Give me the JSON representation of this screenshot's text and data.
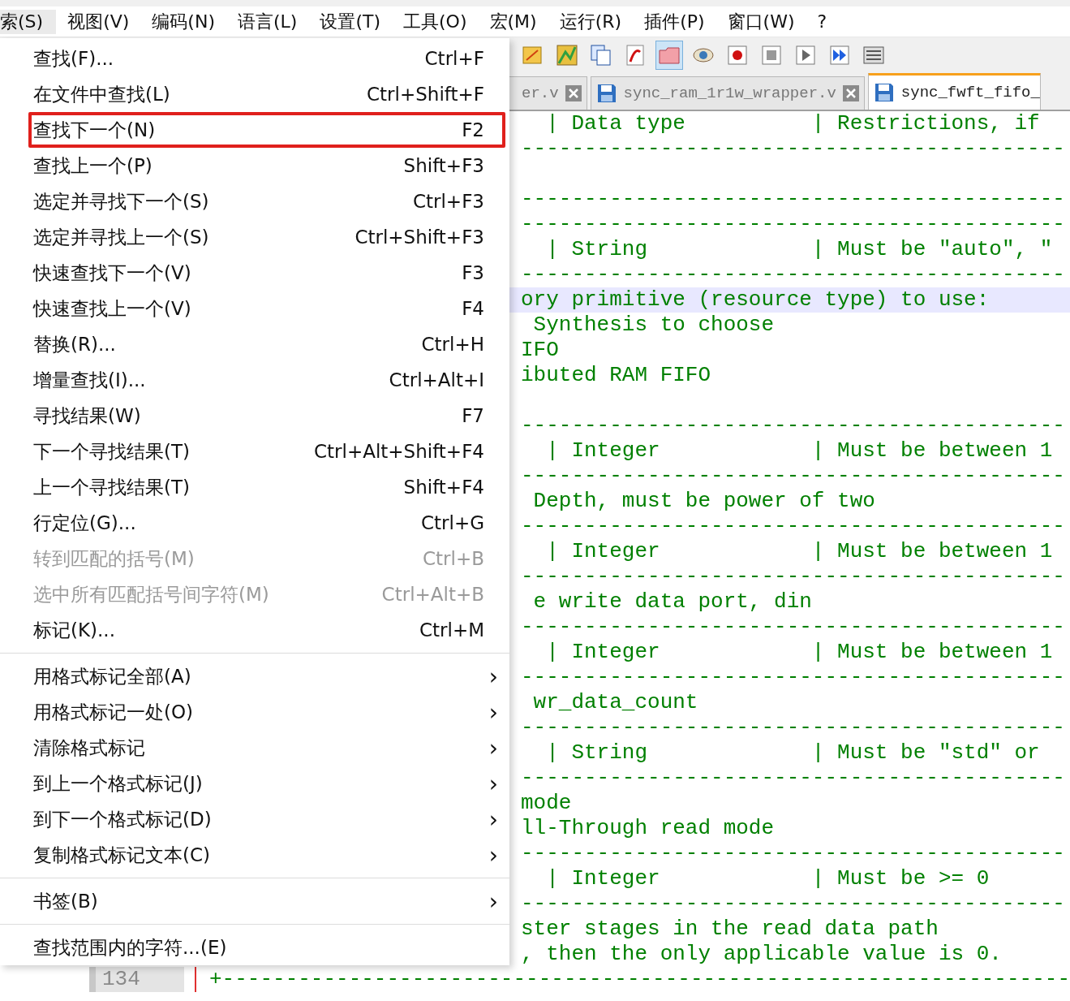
{
  "menubar": {
    "items": [
      {
        "label": "索(S)",
        "selected": true
      },
      {
        "label": "视图(V)",
        "selected": false
      },
      {
        "label": "编码(N)",
        "selected": false
      },
      {
        "label": "语言(L)",
        "selected": false
      },
      {
        "label": "设置(T)",
        "selected": false
      },
      {
        "label": "工具(O)",
        "selected": false
      },
      {
        "label": "宏(M)",
        "selected": false
      },
      {
        "label": "运行(R)",
        "selected": false
      },
      {
        "label": "插件(P)",
        "selected": false
      },
      {
        "label": "窗口(W)",
        "selected": false
      },
      {
        "label": "?",
        "selected": false
      }
    ]
  },
  "toolbar": {
    "buttons": [
      {
        "pressed": false
      },
      {
        "pressed": false
      },
      {
        "pressed": false
      },
      {
        "pressed": false
      },
      {
        "pressed": true
      },
      {
        "pressed": false
      },
      {
        "pressed": false
      },
      {
        "pressed": false
      },
      {
        "pressed": false
      },
      {
        "pressed": false
      },
      {
        "pressed": false
      }
    ]
  },
  "tabs": [
    {
      "label": "er.v",
      "selected": false,
      "closable": true,
      "icon": false
    },
    {
      "label": "sync_ram_1r1w_wrapper.v",
      "selected": false,
      "closable": true,
      "icon": true
    },
    {
      "label": "sync_fwft_fifo_",
      "selected": true,
      "closable": false,
      "icon": true
    }
  ],
  "editor": {
    "lines": [
      {
        "text": "  | Data type          | Restrictions, if",
        "highlighted": false
      },
      {
        "text": "-------------------------------------------",
        "highlighted": false
      },
      {
        "highlighted": false
      },
      {
        "text": "-------------------------------------------",
        "highlighted": false
      },
      {
        "text": "-------------------------------------------",
        "highlighted": false
      },
      {
        "text": "  | String             | Must be \"auto\", \"",
        "highlighted": false
      },
      {
        "text": "-------------------------------------------",
        "highlighted": false
      },
      {
        "text": "ory primitive (resource type) to use:",
        "highlighted": true
      },
      {
        "text": " Synthesis to choose",
        "highlighted": false
      },
      {
        "text": "IFO",
        "highlighted": false
      },
      {
        "text": "ibuted RAM FIFO",
        "highlighted": false
      },
      {
        "highlighted": false
      },
      {
        "text": "-------------------------------------------",
        "highlighted": false
      },
      {
        "text": "  | Integer            | Must be between 1",
        "highlighted": false
      },
      {
        "text": "-------------------------------------------",
        "highlighted": false
      },
      {
        "text": " Depth, must be power of two",
        "highlighted": false
      },
      {
        "text": "-------------------------------------------",
        "highlighted": false
      },
      {
        "text": "  | Integer            | Must be between 1",
        "highlighted": false
      },
      {
        "text": "-------------------------------------------",
        "highlighted": false
      },
      {
        "text": " e write data port, din",
        "highlighted": false
      },
      {
        "text": "-------------------------------------------",
        "highlighted": false
      },
      {
        "text": "  | Integer            | Must be between 1",
        "highlighted": false
      },
      {
        "text": "-------------------------------------------",
        "highlighted": false
      },
      {
        "text": " wr_data_count",
        "highlighted": false
      },
      {
        "text": "-------------------------------------------",
        "highlighted": false
      },
      {
        "text": "  | String             | Must be \"std\" or",
        "highlighted": false
      },
      {
        "text": "-------------------------------------------",
        "highlighted": false
      },
      {
        "text": "mode",
        "highlighted": false
      },
      {
        "text": "ll-Through read mode",
        "highlighted": false
      },
      {
        "text": "-------------------------------------------",
        "highlighted": false
      },
      {
        "text": "  | Integer            | Must be >= 0",
        "highlighted": false
      },
      {
        "text": "-------------------------------------------",
        "highlighted": false
      },
      {
        "text": "ster stages in the read data path",
        "highlighted": false
      },
      {
        "text": ", then the only applicable value is 0.",
        "highlighted": false
      }
    ],
    "last_line": {
      "number": "134",
      "text": "+-------------------------------------------------------------------"
    }
  },
  "menu": {
    "items": [
      {
        "kind": "command",
        "label": "查找(F)...",
        "shortcut": "Ctrl+F",
        "disabled": false,
        "annotated": false
      },
      {
        "kind": "command",
        "label": "在文件中查找(L)",
        "shortcut": "Ctrl+Shift+F",
        "disabled": false,
        "annotated": false
      },
      {
        "kind": "command",
        "label": "查找下一个(N)",
        "shortcut": "F2",
        "disabled": false,
        "annotated": true
      },
      {
        "kind": "command",
        "label": "查找上一个(P)",
        "shortcut": "Shift+F3",
        "disabled": false,
        "annotated": false
      },
      {
        "kind": "command",
        "label": "选定并寻找下一个(S)",
        "shortcut": "Ctrl+F3",
        "disabled": false,
        "annotated": false
      },
      {
        "kind": "command",
        "label": "选定并寻找上一个(S)",
        "shortcut": "Ctrl+Shift+F3",
        "disabled": false,
        "annotated": false
      },
      {
        "kind": "command",
        "label": "快速查找下一个(V)",
        "shortcut": "F3",
        "disabled": false,
        "annotated": false
      },
      {
        "kind": "command",
        "label": "快速查找上一个(V)",
        "shortcut": "F4",
        "disabled": false,
        "annotated": false
      },
      {
        "kind": "command",
        "label": "替换(R)...",
        "shortcut": "Ctrl+H",
        "disabled": false,
        "annotated": false
      },
      {
        "kind": "command",
        "label": "增量查找(I)...",
        "shortcut": "Ctrl+Alt+I",
        "disabled": false,
        "annotated": false
      },
      {
        "kind": "command",
        "label": "寻找结果(W)",
        "shortcut": "F7",
        "disabled": false,
        "annotated": false
      },
      {
        "kind": "command",
        "label": "下一个寻找结果(T)",
        "shortcut": "Ctrl+Alt+Shift+F4",
        "disabled": false,
        "annotated": false
      },
      {
        "kind": "command",
        "label": "上一个寻找结果(T)",
        "shortcut": "Shift+F4",
        "disabled": false,
        "annotated": false
      },
      {
        "kind": "command",
        "label": "行定位(G)...",
        "shortcut": "Ctrl+G",
        "disabled": false,
        "annotated": false
      },
      {
        "kind": "command",
        "label": "转到匹配的括号(M)",
        "shortcut": "Ctrl+B",
        "disabled": true,
        "annotated": false
      },
      {
        "kind": "command",
        "label": "选中所有匹配括号间字符(M)",
        "shortcut": "Ctrl+Alt+B",
        "disabled": true,
        "annotated": false
      },
      {
        "kind": "command",
        "label": "标记(K)...",
        "shortcut": "Ctrl+M",
        "disabled": false,
        "annotated": false
      },
      {
        "kind": "separator"
      },
      {
        "kind": "submenu",
        "label": "用格式标记全部(A)",
        "arrow": "›",
        "disabled": false,
        "annotated": false
      },
      {
        "kind": "submenu",
        "label": "用格式标记一处(O)",
        "arrow": "›",
        "disabled": false,
        "annotated": false
      },
      {
        "kind": "submenu",
        "label": "清除格式标记",
        "arrow": "›",
        "disabled": false,
        "annotated": false
      },
      {
        "kind": "submenu",
        "label": "到上一个格式标记(J)",
        "arrow": "›",
        "disabled": false,
        "annotated": false
      },
      {
        "kind": "submenu",
        "label": "到下一个格式标记(D)",
        "arrow": "›",
        "disabled": false,
        "annotated": false
      },
      {
        "kind": "submenu",
        "label": "复制格式标记文本(C)",
        "arrow": "›",
        "disabled": false,
        "annotated": false
      },
      {
        "kind": "separator"
      },
      {
        "kind": "submenu",
        "label": "书签(B)",
        "arrow": "›",
        "disabled": false,
        "annotated": false
      },
      {
        "kind": "separator"
      },
      {
        "kind": "command",
        "label": "查找范围内的字符...(E)",
        "disabled": false,
        "annotated": false
      }
    ]
  }
}
